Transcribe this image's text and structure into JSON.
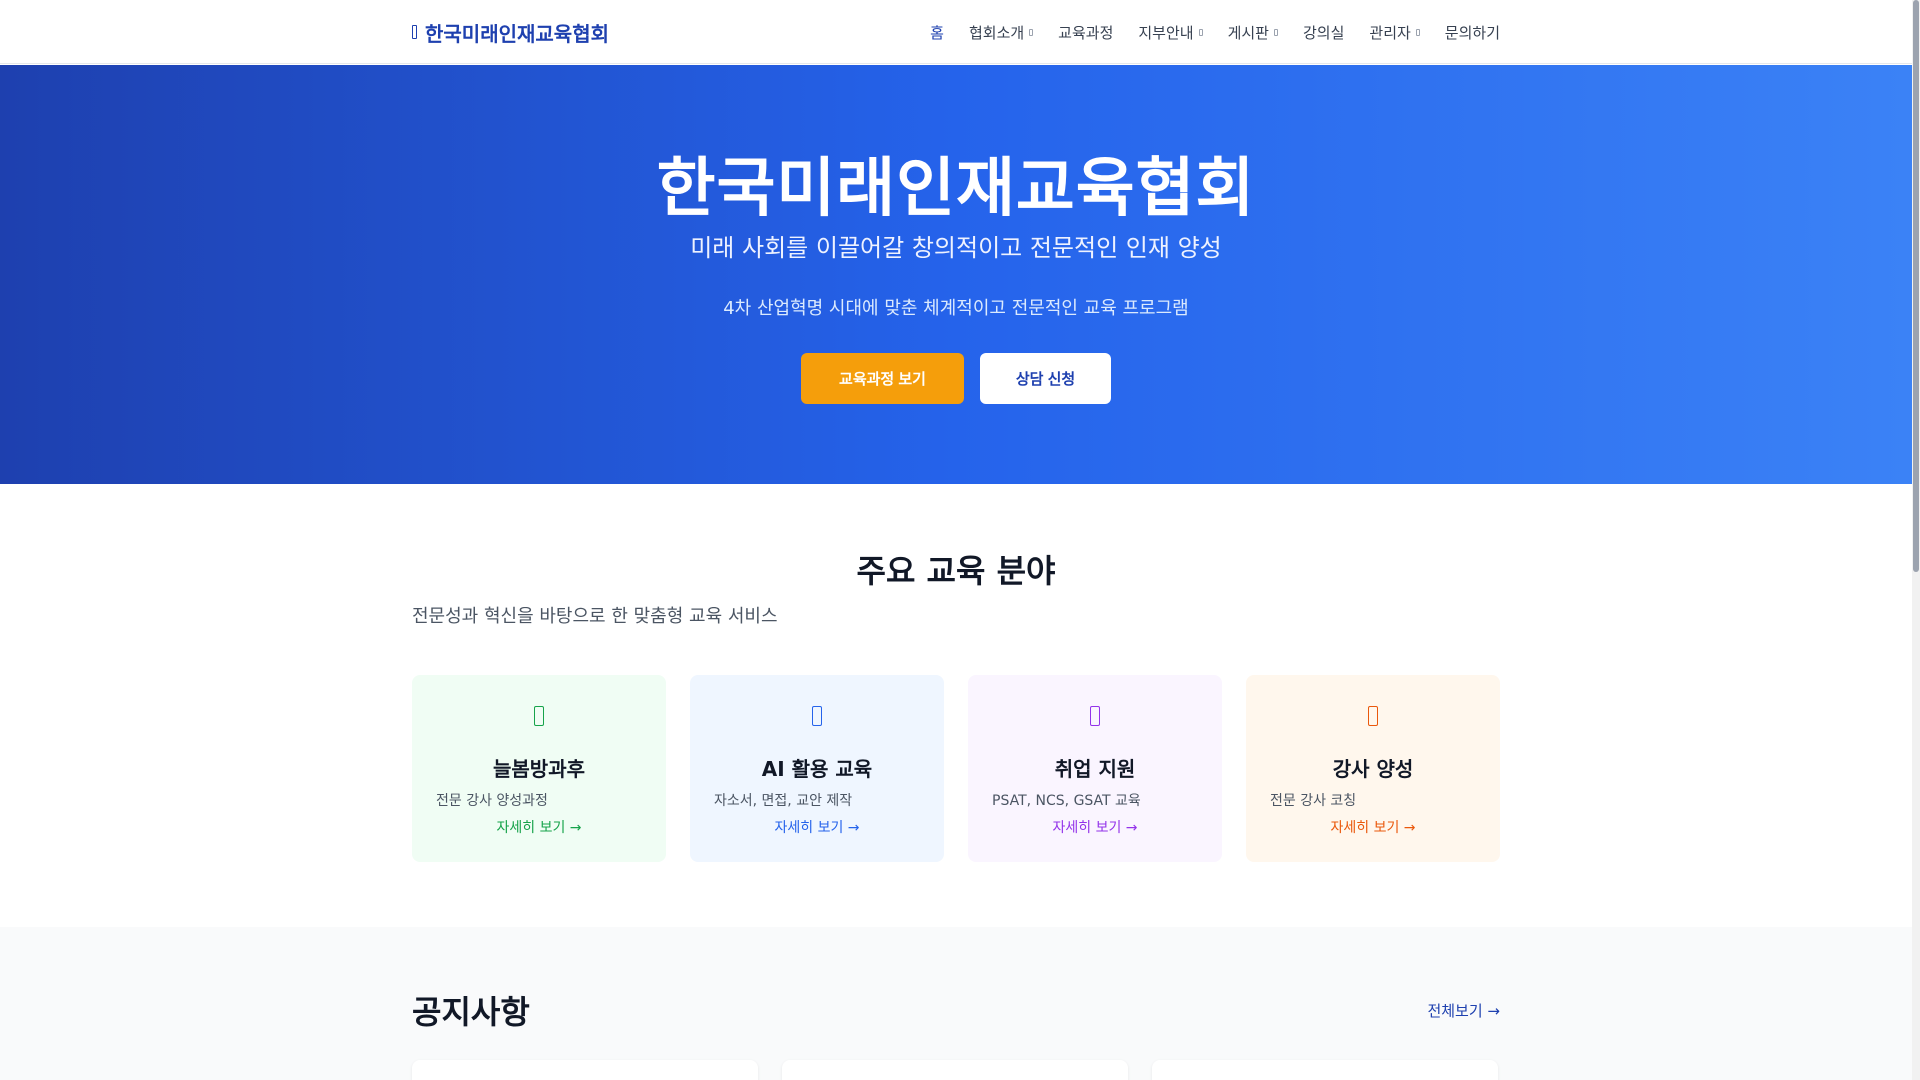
{
  "header": {
    "logo": "한국미래인재교육협회",
    "nav": [
      {
        "label": "홈",
        "dropdown": false
      },
      {
        "label": "협회소개",
        "dropdown": true
      },
      {
        "label": "교육과정",
        "dropdown": false
      },
      {
        "label": "지부안내",
        "dropdown": true
      },
      {
        "label": "게시판",
        "dropdown": true
      },
      {
        "label": "강의실",
        "dropdown": false
      },
      {
        "label": "관리자",
        "dropdown": true
      },
      {
        "label": "문의하기",
        "dropdown": false
      }
    ]
  },
  "hero": {
    "title": "한국미래인재교육협회",
    "subtitle": "미래 사회를 이끌어갈 창의적이고 전문적인 인재 양성",
    "description": "4차 산업혁명 시대에 맞춘 체계적이고 전문적인 교육 프로그램",
    "primary_button": "교육과정 보기",
    "secondary_button": "상담 신청"
  },
  "programs": {
    "title": "주요 교육 분야",
    "subtitle": "전문성과 혁신을 바탕으로 한 맞춤형 교육 서비스",
    "cards": [
      {
        "title": "늘봄방과후",
        "description": "전문 강사 양성과정",
        "link": "자세히 보기 →",
        "color": "#16a34a"
      },
      {
        "title": "AI 활용 교육",
        "description": "자소서, 면접, 교안 제작",
        "link": "자세히 보기 →",
        "color": "#2563eb"
      },
      {
        "title": "취업 지원",
        "description": "PSAT, NCS, GSAT 교육",
        "link": "자세히 보기 →",
        "color": "#9333ea"
      },
      {
        "title": "강사 양성",
        "description": "전문 강사 코칭",
        "link": "자세히 보기 →",
        "color": "#ea580c"
      }
    ]
  },
  "notice": {
    "title": "공지사항",
    "view_all": "전체보기 →"
  },
  "colors": {
    "brand": "#1e40af",
    "accent": "#f59e0b"
  }
}
